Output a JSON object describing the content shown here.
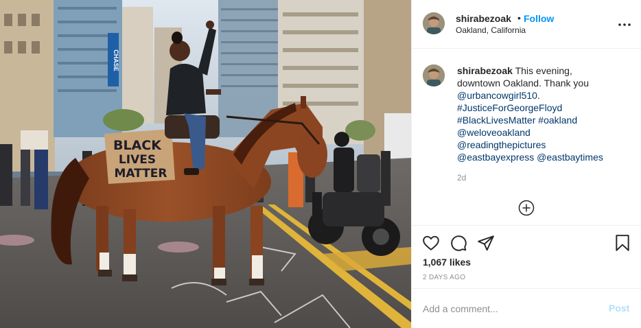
{
  "post": {
    "photo": {
      "sign_line1": "BLACK",
      "sign_line2": "LIVES",
      "sign_line3": "MATTER",
      "building_sign": "CHASE"
    },
    "header": {
      "username": "shirabezoak",
      "separator": "•",
      "follow_label": "Follow",
      "location": "Oakland, California",
      "more_icon": "more-horizontal-icon"
    },
    "caption": {
      "username": "shirabezoak",
      "line1": "This evening,",
      "line2": "downtown Oakland. Thank you",
      "mention_urbancowgirl": "@urbancowgirl510",
      "mention_urbancowgirl_suffix": ".",
      "hashtag_justice": "#JusticeForGeorgeFloyd",
      "hashtag_blm": "#BlackLivesMatter",
      "hashtag_oakland": "#oakland",
      "mention_weloveoakland": "@weloveoakland",
      "mention_readingthepictures": "@readingthepictures",
      "mention_eastbayexpress": "@eastbayexpress",
      "mention_eastbaytimes": "@eastbaytimes",
      "time_ago": "2d",
      "load_more_icon": "plus-circle-icon"
    },
    "actions": {
      "like_icon": "heart-icon",
      "comment_icon": "comment-icon",
      "share_icon": "share-icon",
      "save_icon": "bookmark-icon",
      "likes": "1,067 likes",
      "date": "2 DAYS AGO"
    },
    "comment_box": {
      "placeholder": "Add a comment...",
      "post_label": "Post"
    },
    "colors": {
      "link": "#00376b",
      "follow": "#0095f6",
      "post_disabled": "#b2dffc",
      "muted": "#8e8e8e",
      "text": "#262626"
    }
  }
}
